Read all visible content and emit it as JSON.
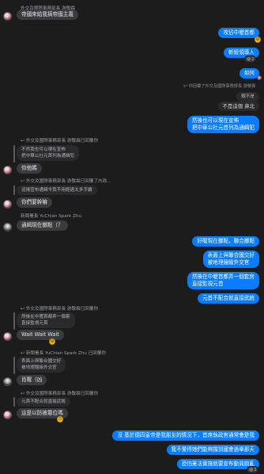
{
  "messages": {
    "m1_sender": "外交及國際事務部長 游敬霖",
    "m1_text": "帝國來給我搞帝國主義",
    "m2_text": "攻佔中壢首都",
    "m3_text": "斬殺領導人",
    "m3_react_count": "2",
    "m4_text": "如何",
    "r1_header": "你回覆了外交及國際事務部長 游敬霖",
    "r1_q1": "戰不是",
    "r1_q2": "不是這個 鼻北",
    "r1_text1": "然後也可以現在宣佈",
    "r1_text2": "把中華公社元首列為通緝犯",
    "r2_sender": "外交及國際事務部長 游敬霖已回覆你",
    "r2_quote1": "不然我也可以現在宣佈",
    "r2_quote2": "把中華公社元首列為通緝犯",
    "r2_text": "你他媽",
    "r3_sender": "外交及國際事務部長 游敬霖已回覆了內政...",
    "r3_quote": "這樣宣布通緝令我不用經過太多手續",
    "r3_text": "你們要幹嘛",
    "m5_sender": "新聞署長 YuChian Spark Zhu",
    "m5_text": "通緝現在擲點（？",
    "m6_text": "好喔現在擲點，聯合擲點",
    "m7_text1": "表面上與聯合國交好",
    "m7_text2": "被地理鐘級外交官",
    "m8_text1": "然後在中壢首都弄一個套房",
    "m8_text2": "直接監視元首",
    "m9_text": "元首不配合就直接武統",
    "r4_sender": "外交及國際事務部長 游敬霖已回覆你",
    "r4_quote1": "然後在中壢首都弄一個套",
    "r4_quote2": "直接監視元首",
    "r4_text": "Wait Wait Wait",
    "r5_sender": "新聞署長 YuChian Spark Zhu 已回覆你",
    "r5_quote1": "表面上與聯合國交好",
    "r5_quote2": "被地理鐘級外交官",
    "r5_text": "肖喔（凶",
    "r6_sender": "外交及國際事務部長 游敬霖已回覆你",
    "r6_quote": "元首不配合就直接武統",
    "r6_text": "這是以防被篡位嗎",
    "m10_text": "沒 基於德四皇帝是我朋友的情況下，首席執政官通常會是我",
    "m11_text": "我不覺得她們能夠撐到國會過舉那天",
    "m12_text": "恐怕憲法實施就要宣布動員戡亂",
    "m12_react_count": "3"
  },
  "colors": {
    "background": "#1c1c1d",
    "outgoing_bubble": "#0a7cff",
    "incoming_bubble": "#3a3b3d",
    "quoted_bubble": "#2a2a2c"
  }
}
